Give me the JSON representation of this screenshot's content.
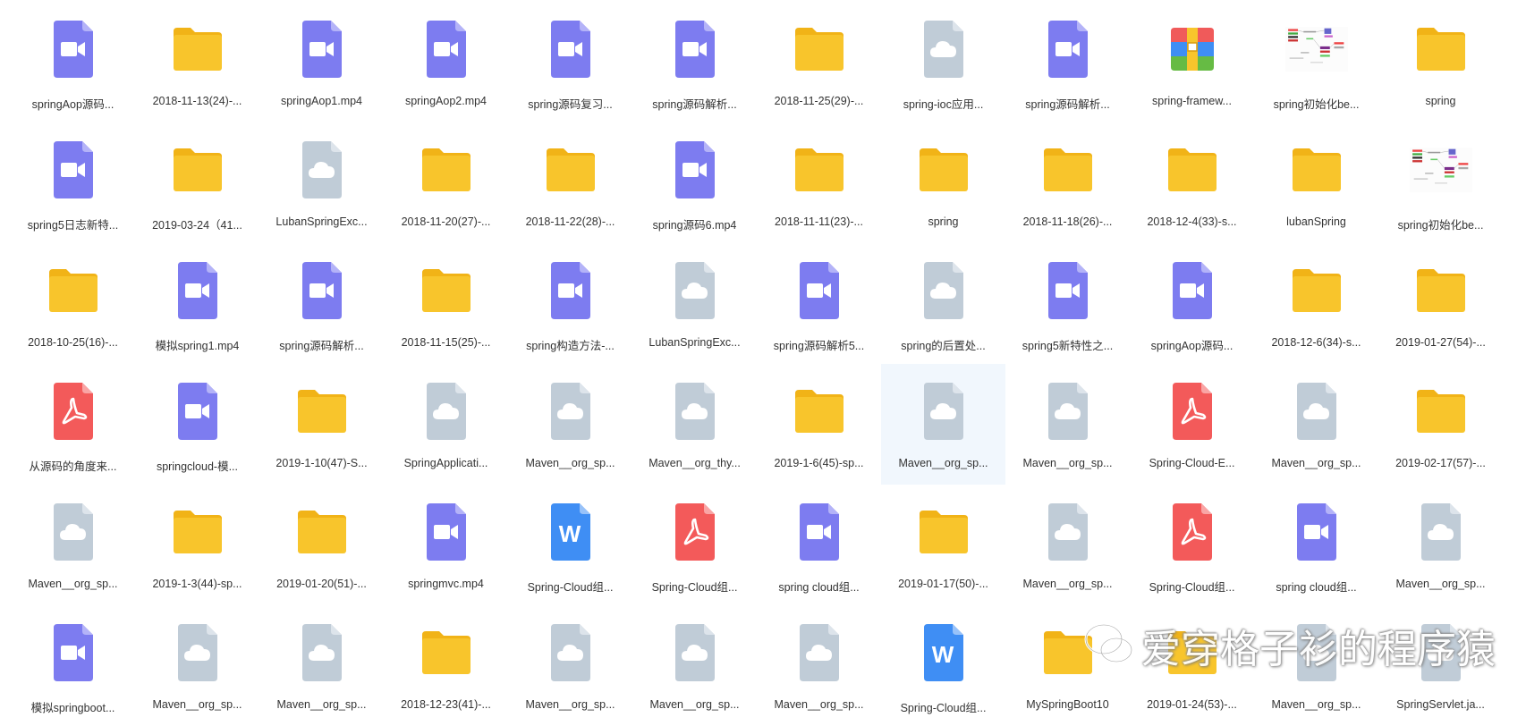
{
  "colors": {
    "video": "#7d7cf0",
    "folder": "#f8c52c",
    "folder_tab": "#f1b317",
    "cloud": "#c0ccd7",
    "pdf": "#f35a5a",
    "word": "#3f8ef4",
    "selected_bg": "#f1f7fd",
    "label": "#333333"
  },
  "files": [
    {
      "name": "springAop源码...",
      "type": "video"
    },
    {
      "name": "2018-11-13(24)-...",
      "type": "folder"
    },
    {
      "name": "springAop1.mp4",
      "type": "video"
    },
    {
      "name": "springAop2.mp4",
      "type": "video"
    },
    {
      "name": "spring源码复习...",
      "type": "video"
    },
    {
      "name": "spring源码解析...",
      "type": "video"
    },
    {
      "name": "2018-11-25(29)-...",
      "type": "folder"
    },
    {
      "name": "spring-ioc应用...",
      "type": "cloud"
    },
    {
      "name": "spring源码解析...",
      "type": "video"
    },
    {
      "name": "spring-framew...",
      "type": "archive"
    },
    {
      "name": "spring初始化be...",
      "type": "image"
    },
    {
      "name": "spring",
      "type": "folder"
    },
    {
      "name": "spring5日志新特...",
      "type": "video"
    },
    {
      "name": "2019-03-24（41...",
      "type": "folder"
    },
    {
      "name": "LubanSpringExc...",
      "type": "cloud"
    },
    {
      "name": "2018-11-20(27)-...",
      "type": "folder"
    },
    {
      "name": "2018-11-22(28)-...",
      "type": "folder"
    },
    {
      "name": "spring源码6.mp4",
      "type": "video"
    },
    {
      "name": "2018-11-11(23)-...",
      "type": "folder"
    },
    {
      "name": "spring",
      "type": "folder"
    },
    {
      "name": "2018-11-18(26)-...",
      "type": "folder"
    },
    {
      "name": "2018-12-4(33)-s...",
      "type": "folder"
    },
    {
      "name": "lubanSpring",
      "type": "folder"
    },
    {
      "name": "spring初始化be...",
      "type": "image"
    },
    {
      "name": "2018-10-25(16)-...",
      "type": "folder"
    },
    {
      "name": "模拟spring1.mp4",
      "type": "video"
    },
    {
      "name": "spring源码解析...",
      "type": "video"
    },
    {
      "name": "2018-11-15(25)-...",
      "type": "folder"
    },
    {
      "name": "spring构造方法-...",
      "type": "video"
    },
    {
      "name": "LubanSpringExc...",
      "type": "cloud"
    },
    {
      "name": "spring源码解析5...",
      "type": "video"
    },
    {
      "name": "spring的后置处...",
      "type": "cloud"
    },
    {
      "name": "spring5新特性之...",
      "type": "video"
    },
    {
      "name": "springAop源码...",
      "type": "video"
    },
    {
      "name": "2018-12-6(34)-s...",
      "type": "folder"
    },
    {
      "name": "2019-01-27(54)-...",
      "type": "folder"
    },
    {
      "name": "从源码的角度来...",
      "type": "pdf"
    },
    {
      "name": "springcloud-模...",
      "type": "video"
    },
    {
      "name": "2019-1-10(47)-S...",
      "type": "folder"
    },
    {
      "name": "SpringApplicati...",
      "type": "cloud"
    },
    {
      "name": "Maven__org_sp...",
      "type": "cloud"
    },
    {
      "name": "Maven__org_thy...",
      "type": "cloud"
    },
    {
      "name": "2019-1-6(45)-sp...",
      "type": "folder"
    },
    {
      "name": "Maven__org_sp...",
      "type": "cloud",
      "selected": true
    },
    {
      "name": "Maven__org_sp...",
      "type": "cloud"
    },
    {
      "name": "Spring-Cloud-E...",
      "type": "pdf"
    },
    {
      "name": "Maven__org_sp...",
      "type": "cloud"
    },
    {
      "name": "2019-02-17(57)-...",
      "type": "folder"
    },
    {
      "name": "Maven__org_sp...",
      "type": "cloud"
    },
    {
      "name": "2019-1-3(44)-sp...",
      "type": "folder"
    },
    {
      "name": "2019-01-20(51)-...",
      "type": "folder"
    },
    {
      "name": "springmvc.mp4",
      "type": "video"
    },
    {
      "name": "Spring-Cloud组...",
      "type": "word"
    },
    {
      "name": "Spring-Cloud组...",
      "type": "pdf"
    },
    {
      "name": "spring cloud组...",
      "type": "video"
    },
    {
      "name": "2019-01-17(50)-...",
      "type": "folder"
    },
    {
      "name": "Maven__org_sp...",
      "type": "cloud"
    },
    {
      "name": "Spring-Cloud组...",
      "type": "pdf"
    },
    {
      "name": "spring cloud组...",
      "type": "video"
    },
    {
      "name": "Maven__org_sp...",
      "type": "cloud"
    },
    {
      "name": "模拟springboot...",
      "type": "video"
    },
    {
      "name": "Maven__org_sp...",
      "type": "cloud"
    },
    {
      "name": "Maven__org_sp...",
      "type": "cloud"
    },
    {
      "name": "2018-12-23(41)-...",
      "type": "folder"
    },
    {
      "name": "Maven__org_sp...",
      "type": "cloud"
    },
    {
      "name": "Maven__org_sp...",
      "type": "cloud"
    },
    {
      "name": "Maven__org_sp...",
      "type": "cloud"
    },
    {
      "name": "Spring-Cloud组...",
      "type": "word"
    },
    {
      "name": "MySpringBoot10",
      "type": "folder"
    },
    {
      "name": "2019-01-24(53)-...",
      "type": "folder"
    },
    {
      "name": "Maven__org_sp...",
      "type": "cloud"
    },
    {
      "name": "SpringServlet.ja...",
      "type": "cloud"
    }
  ],
  "watermark": {
    "text": "爱穿格子衫的程序猿",
    "icon": "wechat-icon"
  }
}
